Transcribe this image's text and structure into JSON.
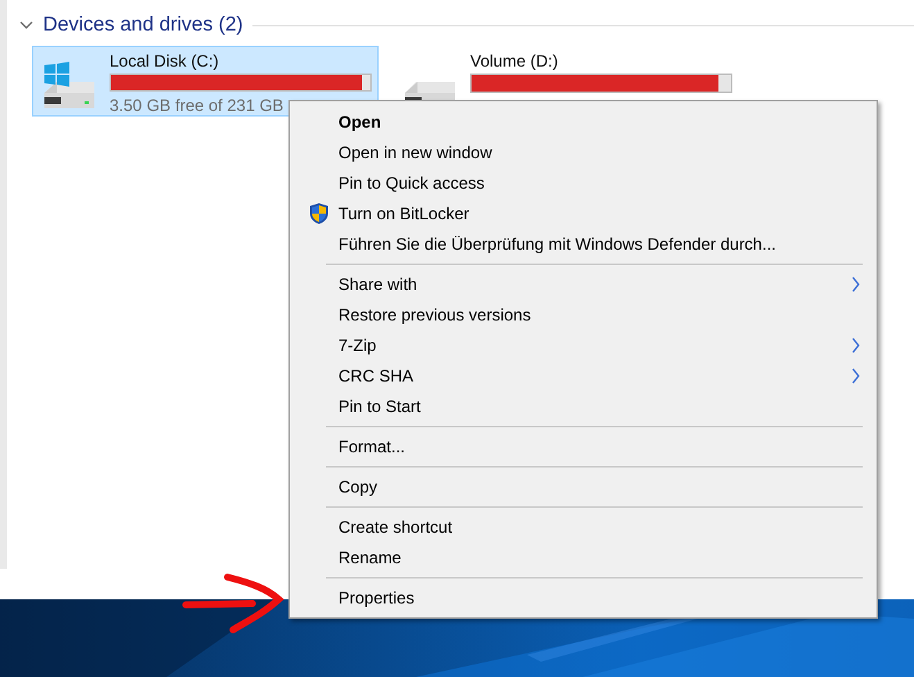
{
  "section": {
    "title": "Devices and drives (2)",
    "expanded": true
  },
  "drives": [
    {
      "name": "Local Disk (C:)",
      "level": 0.97,
      "free_text": "3.50 GB free of 231 GB",
      "selected": true,
      "kind": "system"
    },
    {
      "name": "Volume (D:)",
      "level": 0.95,
      "selected": false,
      "kind": "data"
    }
  ],
  "context_menu": {
    "items": [
      {
        "kind": "item",
        "label": "Open",
        "bold": true,
        "submenu": false
      },
      {
        "kind": "item",
        "label": "Open in new window",
        "bold": false,
        "submenu": false
      },
      {
        "kind": "item",
        "label": "Pin to Quick access",
        "bold": false,
        "submenu": false
      },
      {
        "kind": "shield_item",
        "label": "Turn on BitLocker",
        "bold": false,
        "submenu": false
      },
      {
        "kind": "item",
        "label": "Führen Sie die Überprüfung mit Windows Defender durch...",
        "bold": false,
        "submenu": false
      },
      {
        "kind": "separator"
      },
      {
        "kind": "item",
        "label": "Share with",
        "bold": false,
        "submenu": true
      },
      {
        "kind": "item",
        "label": "Restore previous versions",
        "bold": false,
        "submenu": false
      },
      {
        "kind": "item",
        "label": "7-Zip",
        "bold": false,
        "submenu": true
      },
      {
        "kind": "item",
        "label": "CRC SHA",
        "bold": false,
        "submenu": true
      },
      {
        "kind": "item",
        "label": "Pin to Start",
        "bold": false,
        "submenu": false
      },
      {
        "kind": "separator"
      },
      {
        "kind": "item",
        "label": "Format...",
        "bold": false,
        "submenu": false
      },
      {
        "kind": "separator"
      },
      {
        "kind": "item",
        "label": "Copy",
        "bold": false,
        "submenu": false
      },
      {
        "kind": "separator"
      },
      {
        "kind": "item",
        "label": "Create shortcut",
        "bold": false,
        "submenu": false
      },
      {
        "kind": "item",
        "label": "Rename",
        "bold": false,
        "submenu": false
      },
      {
        "kind": "separator"
      },
      {
        "kind": "item",
        "label": "Properties",
        "bold": false,
        "submenu": false
      }
    ]
  },
  "annotation": {
    "kind": "arrow"
  }
}
